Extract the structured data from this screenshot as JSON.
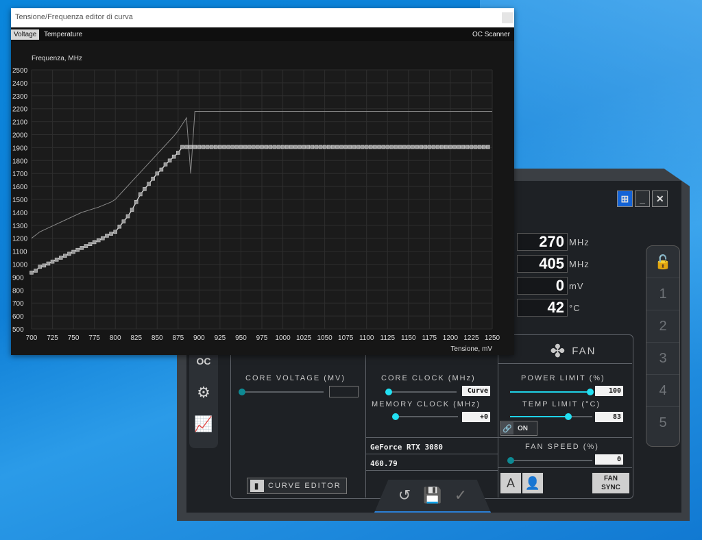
{
  "afterburner": {
    "readouts": [
      {
        "value": "270",
        "unit": "MHz"
      },
      {
        "value": "405",
        "unit": "MHz"
      },
      {
        "value": "0",
        "unit": "mV"
      },
      {
        "value": "42",
        "unit": "°C"
      }
    ],
    "profiles": [
      "1",
      "2",
      "3",
      "4",
      "5"
    ],
    "fan_header": "FAN",
    "labels": {
      "core_voltage": "CORE VOLTAGE  (MV)",
      "core_clock": "CORE CLOCK (MHz)",
      "memory_clock": "MEMORY CLOCK (MHz)",
      "power_limit": "POWER LIMIT (%)",
      "temp_limit": "TEMP LIMIT (°C)",
      "fan_speed": "FAN SPEED (%)"
    },
    "values": {
      "core_clock": "Curve",
      "memory_clock": "+0",
      "power_limit": "100",
      "temp_limit": "83",
      "fan_speed": "0"
    },
    "gpu_name": "GeForce RTX 3080",
    "driver": "460.79",
    "buttons": {
      "curve_editor": "CURVE EDITOR",
      "link_on": "ON",
      "fan_sync_line1": "FAN",
      "fan_sync_line2": "SYNC"
    },
    "colors": {
      "accent": "#22e0f2",
      "frame": "#3b3f44"
    }
  },
  "curve_editor": {
    "title": "Tensione/Frequenza editor di curva",
    "tabs": [
      "Voltage",
      "Temperature"
    ],
    "oc_scanner": "OC Scanner",
    "ylabel": "Frequenza, MHz",
    "xlabel": "Tensione, mV"
  },
  "chart_data": {
    "type": "line",
    "ylabel": "Frequenza, MHz",
    "xlabel": "Tensione, mV",
    "xlim": [
      700,
      1250
    ],
    "ylim": [
      500,
      2500
    ],
    "xticks": [
      700,
      725,
      750,
      775,
      800,
      825,
      850,
      875,
      900,
      925,
      950,
      975,
      1000,
      1025,
      1050,
      1075,
      1100,
      1125,
      1150,
      1175,
      1200,
      1225,
      1250
    ],
    "yticks": [
      500,
      600,
      700,
      800,
      900,
      1000,
      1100,
      1200,
      1300,
      1400,
      1500,
      1600,
      1700,
      1800,
      1900,
      2000,
      2100,
      2200,
      2300,
      2400,
      2500
    ],
    "series": [
      {
        "values_x": [
          700,
          710,
          720,
          740,
          760,
          780,
          795,
          800,
          810,
          820,
          830,
          840,
          850,
          860,
          870,
          875,
          880,
          885,
          890,
          895,
          900,
          925,
          950,
          1000,
          1050,
          1100,
          1150,
          1200,
          1250
        ],
        "values_y": [
          1200,
          1250,
          1280,
          1340,
          1400,
          1440,
          1480,
          1500,
          1570,
          1640,
          1710,
          1780,
          1850,
          1920,
          1990,
          2030,
          2080,
          2130,
          1700,
          2180,
          2180,
          2180,
          2180,
          2180,
          2180,
          2180,
          2180,
          2180,
          2180
        ]
      },
      {
        "points_x": [
          700,
          705,
          710,
          715,
          720,
          725,
          730,
          735,
          740,
          745,
          750,
          755,
          760,
          765,
          770,
          775,
          780,
          785,
          790,
          795,
          800,
          805,
          810,
          815,
          820,
          825,
          830,
          835,
          840,
          845,
          850,
          855,
          860,
          865,
          870,
          875,
          880,
          885,
          890,
          895,
          900,
          905,
          910,
          915,
          920,
          925,
          930,
          935,
          940,
          945,
          950,
          955,
          960,
          965,
          970,
          975,
          980,
          985,
          990,
          995,
          1000,
          1005,
          1010,
          1015,
          1020,
          1025,
          1030,
          1035,
          1040,
          1045,
          1050,
          1055,
          1060,
          1065,
          1070,
          1075,
          1080,
          1085,
          1090,
          1095,
          1100,
          1105,
          1110,
          1115,
          1120,
          1125,
          1130,
          1135,
          1140,
          1145,
          1150,
          1155,
          1160,
          1165,
          1170,
          1175,
          1180,
          1185,
          1190,
          1195,
          1200,
          1205,
          1210,
          1215,
          1220,
          1225,
          1230,
          1235,
          1240,
          1245
        ],
        "points_y": [
          935,
          950,
          980,
          990,
          1005,
          1020,
          1035,
          1050,
          1065,
          1080,
          1095,
          1110,
          1125,
          1140,
          1155,
          1170,
          1185,
          1200,
          1220,
          1235,
          1250,
          1290,
          1330,
          1370,
          1420,
          1480,
          1540,
          1580,
          1620,
          1660,
          1700,
          1730,
          1770,
          1800,
          1830,
          1860,
          1905,
          1905,
          1905,
          1905,
          1905,
          1905,
          1905,
          1905,
          1905,
          1905,
          1905,
          1905,
          1905,
          1905,
          1905,
          1905,
          1905,
          1905,
          1905,
          1905,
          1905,
          1905,
          1905,
          1905,
          1905,
          1905,
          1905,
          1905,
          1905,
          1905,
          1905,
          1905,
          1905,
          1905,
          1905,
          1905,
          1905,
          1905,
          1905,
          1905,
          1905,
          1905,
          1905,
          1905,
          1905,
          1905,
          1905,
          1905,
          1905,
          1905,
          1905,
          1905,
          1905,
          1905,
          1905,
          1905,
          1905,
          1905,
          1905,
          1905,
          1905,
          1905,
          1905,
          1905,
          1905,
          1905,
          1905,
          1905,
          1905,
          1905,
          1905,
          1905,
          1905,
          1905
        ]
      }
    ],
    "grid": true
  }
}
